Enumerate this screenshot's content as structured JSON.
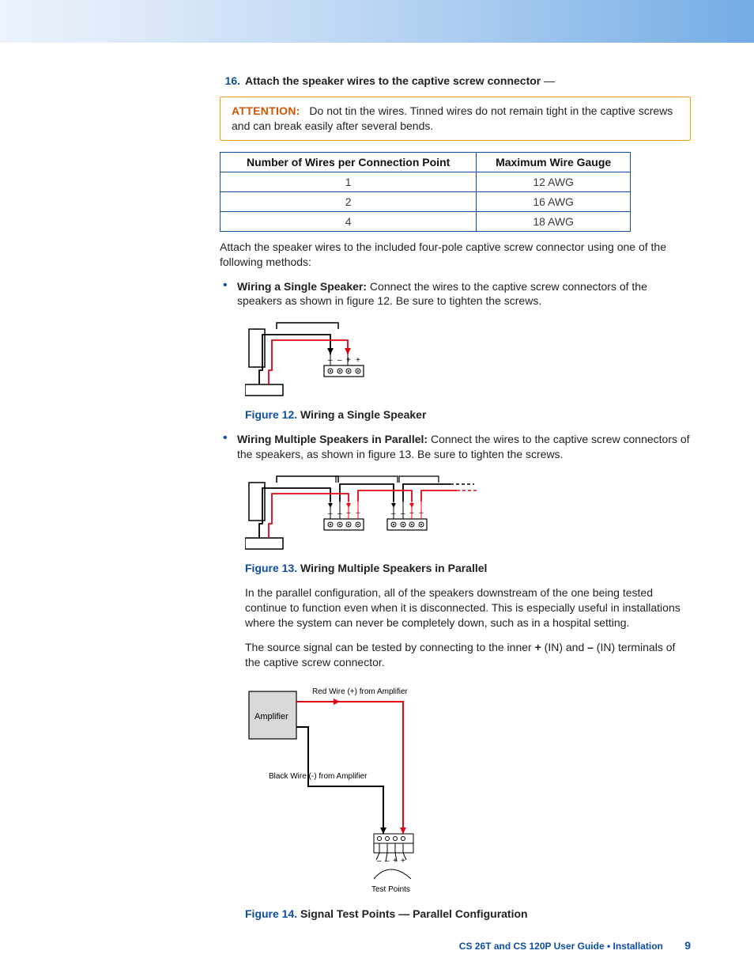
{
  "step": {
    "number": "16.",
    "title": "Attach the speaker wires to the captive screw connector",
    "dash": " —"
  },
  "attention": {
    "label": "ATTENTION:",
    "text": "Do not tin the wires. Tinned wires do not remain tight in the captive screws and can break easily after several bends."
  },
  "table": {
    "headers": [
      "Number of Wires per Connection Point",
      "Maximum Wire Gauge"
    ],
    "rows": [
      [
        "1",
        "12 AWG"
      ],
      [
        "2",
        "16 AWG"
      ],
      [
        "4",
        "18 AWG"
      ]
    ]
  },
  "intro": "Attach the speaker wires to the included four-pole captive screw connector using one of the following methods:",
  "bulletA": {
    "lead": "Wiring a Single Speaker:",
    "text": " Connect the wires to the captive screw connectors of the speakers as shown in figure 12. Be sure to tighten the screws."
  },
  "fig12": {
    "num": "Figure 12.",
    "title": "  Wiring a Single Speaker"
  },
  "bulletB": {
    "lead": "Wiring Multiple Speakers in Parallel:",
    "text": " Connect the wires to the captive screw connectors of the speakers, as shown in figure 13. Be sure to tighten the screws."
  },
  "fig13": {
    "num": "Figure 13.",
    "title": "  Wiring Multiple Speakers in Parallel"
  },
  "para1": "In the parallel configuration, all of the speakers downstream of the one being tested continue to function even when it is disconnected. This is especially useful in installations where the system can never be completely down, such as in a hospital setting.",
  "para2a": "The source signal can be tested by connecting to the inner ",
  "para2plus": "+",
  "para2b": " (IN) and ",
  "para2minus": "–",
  "para2c": " (IN) terminals of the captive screw connector.",
  "fig14": {
    "num": "Figure 14.",
    "title": "  Signal Test Points — Parallel Configuration",
    "amplifier": "Amplifier",
    "red_label": "Red Wire (+) from Amplifier",
    "black_label": "Black Wire (-) from Amplifier",
    "test_points": "Test Points"
  },
  "footer": {
    "text": "CS 26T and CS 120P User Guide • Installation",
    "page": "9"
  },
  "conn_symbols": {
    "m1": "–",
    "m2": "–",
    "p1": "+",
    "p2": "+"
  }
}
